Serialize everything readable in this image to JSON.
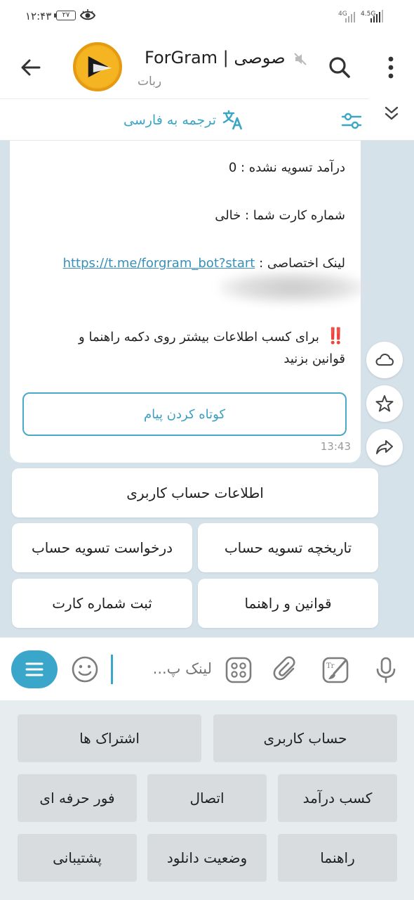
{
  "status_bar": {
    "time": "۱۲:۴۳",
    "battery": "۲۷",
    "network_1": "4G",
    "network_2": "4.5G"
  },
  "header": {
    "title": "ForGram | صوصی",
    "subtitle": "ربات"
  },
  "translate_bar": {
    "label": "ترجمه به فارسی"
  },
  "message": {
    "unsettled_income": "درآمد تسویه نشده  :  0",
    "card_number": "شماره کارت شما : خالی",
    "link_label": "لینک اختصاصی  :",
    "link_url": "https://t.me/forgram_bot?start",
    "info_line_1": "برای کسب اطلاعات بیشتر روی دکمه راهنما و",
    "info_line_2": "قوانین بزنید",
    "warn_icon": "‼️",
    "shorten_button": "کوتاه کردن پیام",
    "time": "13:43"
  },
  "inline_keyboard": {
    "account_info": "اطلاعات حساب کاربری",
    "settlement_history": "تاریخچه تسویه حساب",
    "settlement_request": "درخواست تسویه حساب",
    "rules_guide": "قوانین و راهنما",
    "register_card": "ثبت شماره کارت"
  },
  "input": {
    "placeholder": "لینک پ..."
  },
  "reply_keyboard": {
    "user_account": "حساب کاربری",
    "subscriptions": "اشتراک ها",
    "earn_income": "کسب درآمد",
    "connection": "اتصال",
    "pro_for": "فور حرفه ای",
    "guide": "راهنما",
    "download_status": "وضعیت دانلود",
    "support": "پشتیبانی"
  },
  "colors": {
    "accent": "#3aa6c9",
    "chat_bg": "#d6e2ea",
    "keyboard_bg": "#e7ecef"
  }
}
